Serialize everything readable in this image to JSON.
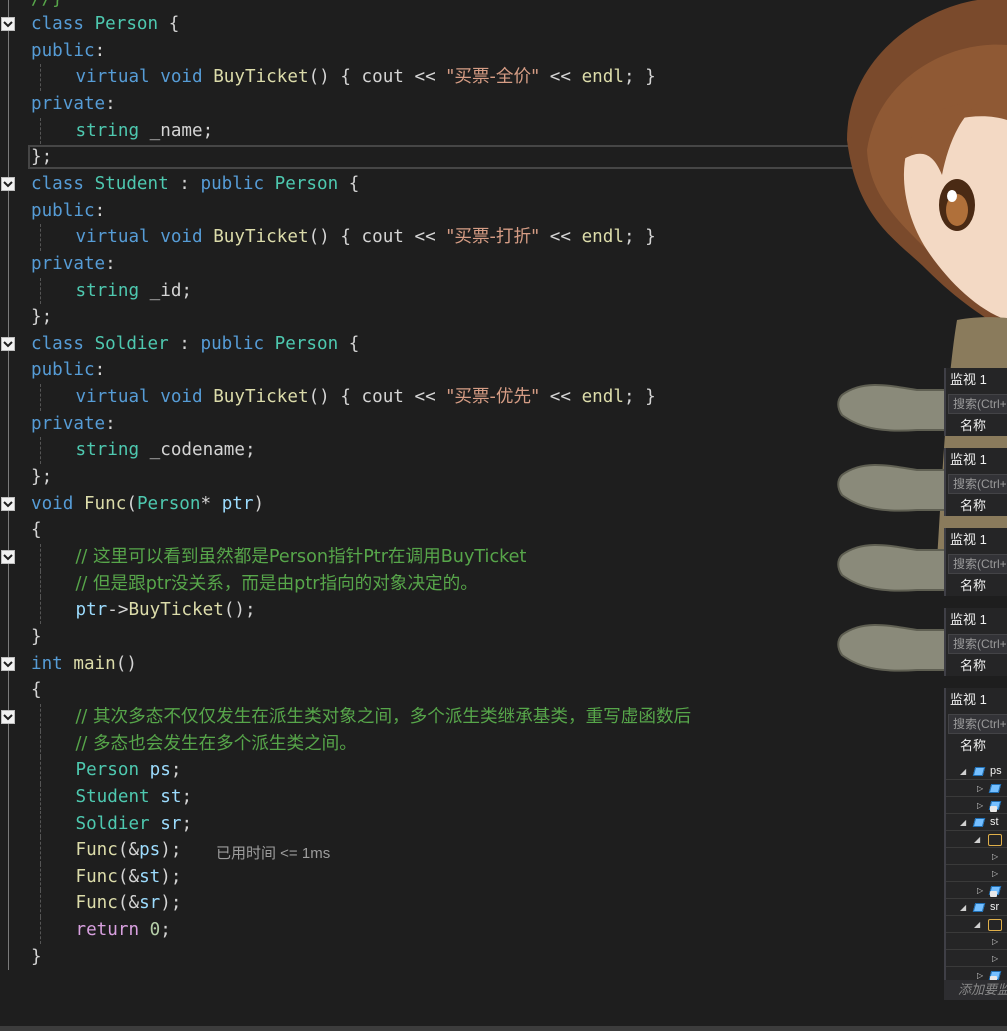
{
  "editor": {
    "top_fragment": "//}",
    "lines": [
      {
        "fold": true,
        "indent": 0,
        "tokens": [
          [
            "kw",
            "class"
          ],
          [
            "pl",
            " "
          ],
          [
            "type",
            "Person"
          ],
          [
            "pl",
            " {"
          ]
        ]
      },
      {
        "fold": false,
        "indent": 0,
        "tokens": [
          [
            "kw",
            "public"
          ],
          [
            "pl",
            ":"
          ]
        ]
      },
      {
        "fold": false,
        "indent": 1,
        "tokens": [
          [
            "kw",
            "virtual"
          ],
          [
            "pl",
            " "
          ],
          [
            "kw",
            "void"
          ],
          [
            "pl",
            " "
          ],
          [
            "fn",
            "BuyTicket"
          ],
          [
            "pl",
            "() { cout << "
          ],
          [
            "str",
            "\"买票-全价\""
          ],
          [
            "pl",
            " << "
          ],
          [
            "fn",
            "endl"
          ],
          [
            "pl",
            "; }"
          ]
        ]
      },
      {
        "fold": false,
        "indent": 0,
        "tokens": [
          [
            "kw",
            "private"
          ],
          [
            "pl",
            ":"
          ]
        ]
      },
      {
        "fold": false,
        "indent": 1,
        "tokens": [
          [
            "type",
            "string"
          ],
          [
            "pl",
            " _name;"
          ]
        ]
      },
      {
        "fold": false,
        "indent": 0,
        "tokens": [
          [
            "pl",
            "};"
          ]
        ]
      },
      {
        "fold": true,
        "indent": 0,
        "tokens": [
          [
            "kw",
            "class"
          ],
          [
            "pl",
            " "
          ],
          [
            "type",
            "Student"
          ],
          [
            "pl",
            " : "
          ],
          [
            "kw",
            "public"
          ],
          [
            "pl",
            " "
          ],
          [
            "type",
            "Person"
          ],
          [
            "pl",
            " {"
          ]
        ]
      },
      {
        "fold": false,
        "indent": 0,
        "tokens": [
          [
            "kw",
            "public"
          ],
          [
            "pl",
            ":"
          ]
        ]
      },
      {
        "fold": false,
        "indent": 1,
        "tokens": [
          [
            "kw",
            "virtual"
          ],
          [
            "pl",
            " "
          ],
          [
            "kw",
            "void"
          ],
          [
            "pl",
            " "
          ],
          [
            "fn",
            "BuyTicket"
          ],
          [
            "pl",
            "() { cout << "
          ],
          [
            "str",
            "\"买票-打折\""
          ],
          [
            "pl",
            " << "
          ],
          [
            "fn",
            "endl"
          ],
          [
            "pl",
            "; }"
          ]
        ]
      },
      {
        "fold": false,
        "indent": 0,
        "tokens": [
          [
            "kw",
            "private"
          ],
          [
            "pl",
            ":"
          ]
        ]
      },
      {
        "fold": false,
        "indent": 1,
        "tokens": [
          [
            "type",
            "string"
          ],
          [
            "pl",
            " _id;"
          ]
        ]
      },
      {
        "fold": false,
        "indent": 0,
        "tokens": [
          [
            "pl",
            "};"
          ]
        ]
      },
      {
        "fold": true,
        "indent": 0,
        "tokens": [
          [
            "kw",
            "class"
          ],
          [
            "pl",
            " "
          ],
          [
            "type",
            "Soldier"
          ],
          [
            "pl",
            " : "
          ],
          [
            "kw",
            "public"
          ],
          [
            "pl",
            " "
          ],
          [
            "type",
            "Person"
          ],
          [
            "pl",
            " {"
          ]
        ]
      },
      {
        "fold": false,
        "indent": 0,
        "tokens": [
          [
            "kw",
            "public"
          ],
          [
            "pl",
            ":"
          ]
        ]
      },
      {
        "fold": false,
        "indent": 1,
        "tokens": [
          [
            "kw",
            "virtual"
          ],
          [
            "pl",
            " "
          ],
          [
            "kw",
            "void"
          ],
          [
            "pl",
            " "
          ],
          [
            "fn",
            "BuyTicket"
          ],
          [
            "pl",
            "() { cout << "
          ],
          [
            "str",
            "\"买票-优先\""
          ],
          [
            "pl",
            " << "
          ],
          [
            "fn",
            "endl"
          ],
          [
            "pl",
            "; }"
          ]
        ]
      },
      {
        "fold": false,
        "indent": 0,
        "tokens": [
          [
            "kw",
            "private"
          ],
          [
            "pl",
            ":"
          ]
        ]
      },
      {
        "fold": false,
        "indent": 1,
        "tokens": [
          [
            "type",
            "string"
          ],
          [
            "pl",
            " _codename;"
          ]
        ]
      },
      {
        "fold": false,
        "indent": 0,
        "tokens": [
          [
            "pl",
            "};"
          ]
        ]
      },
      {
        "fold": true,
        "indent": 0,
        "tokens": [
          [
            "kw",
            "void"
          ],
          [
            "pl",
            " "
          ],
          [
            "fn",
            "Func"
          ],
          [
            "pl",
            "("
          ],
          [
            "type",
            "Person"
          ],
          [
            "pl",
            "* "
          ],
          [
            "var",
            "ptr"
          ],
          [
            "pl",
            ")"
          ]
        ]
      },
      {
        "fold": false,
        "indent": 0,
        "tokens": [
          [
            "pl",
            "{"
          ]
        ]
      },
      {
        "fold": true,
        "indent": 1,
        "tokens": [
          [
            "cm",
            "// 这里可以看到虽然都是Person指针Ptr在调用BuyTicket"
          ]
        ]
      },
      {
        "fold": false,
        "indent": 1,
        "tokens": [
          [
            "cm",
            "// 但是跟ptr没关系，而是由ptr指向的对象决定的。"
          ]
        ]
      },
      {
        "fold": false,
        "indent": 1,
        "tokens": [
          [
            "var",
            "ptr"
          ],
          [
            "pl",
            "->"
          ],
          [
            "fn",
            "BuyTicket"
          ],
          [
            "pl",
            "();"
          ]
        ]
      },
      {
        "fold": false,
        "indent": 0,
        "tokens": [
          [
            "pl",
            "}"
          ]
        ]
      },
      {
        "fold": true,
        "indent": 0,
        "tokens": [
          [
            "kw",
            "int"
          ],
          [
            "pl",
            " "
          ],
          [
            "fn",
            "main"
          ],
          [
            "pl",
            "()"
          ]
        ]
      },
      {
        "fold": false,
        "indent": 0,
        "tokens": [
          [
            "pl",
            "{"
          ]
        ]
      },
      {
        "fold": true,
        "indent": 1,
        "tokens": [
          [
            "cm",
            "// 其次多态不仅仅发生在派生类对象之间，多个派生类继承基类，重写虚函数后"
          ]
        ]
      },
      {
        "fold": false,
        "indent": 1,
        "tokens": [
          [
            "cm",
            "// 多态也会发生在多个派生类之间。"
          ]
        ]
      },
      {
        "fold": false,
        "indent": 1,
        "tokens": [
          [
            "type",
            "Person"
          ],
          [
            "pl",
            " "
          ],
          [
            "var",
            "ps"
          ],
          [
            "pl",
            ";"
          ]
        ]
      },
      {
        "fold": false,
        "indent": 1,
        "tokens": [
          [
            "type",
            "Student"
          ],
          [
            "pl",
            " "
          ],
          [
            "var",
            "st"
          ],
          [
            "pl",
            ";"
          ]
        ]
      },
      {
        "fold": false,
        "indent": 1,
        "tokens": [
          [
            "type",
            "Soldier"
          ],
          [
            "pl",
            " "
          ],
          [
            "var",
            "sr"
          ],
          [
            "pl",
            ";"
          ]
        ]
      },
      {
        "fold": false,
        "indent": 1,
        "tokens": [
          [
            "fn",
            "Func"
          ],
          [
            "pl",
            "(&"
          ],
          [
            "var",
            "ps"
          ],
          [
            "pl",
            ");"
          ]
        ]
      },
      {
        "fold": false,
        "indent": 1,
        "tokens": [
          [
            "fn",
            "Func"
          ],
          [
            "pl",
            "(&"
          ],
          [
            "var",
            "st"
          ],
          [
            "pl",
            ");"
          ]
        ]
      },
      {
        "fold": false,
        "indent": 1,
        "tokens": [
          [
            "fn",
            "Func"
          ],
          [
            "pl",
            "(&"
          ],
          [
            "var",
            "sr"
          ],
          [
            "pl",
            ");"
          ]
        ]
      },
      {
        "fold": false,
        "indent": 1,
        "tokens": [
          [
            "ctl",
            "return"
          ],
          [
            "pl",
            " "
          ],
          [
            "num",
            "0"
          ],
          [
            "pl",
            ";"
          ]
        ]
      },
      {
        "fold": false,
        "indent": 0,
        "tokens": [
          [
            "pl",
            "}"
          ]
        ]
      }
    ],
    "elapsed_hint": "已用时间 <= 1ms"
  },
  "watch_panels": [
    {
      "title": "监视 1",
      "search_placeholder": "搜索(Ctrl+E)",
      "name_header": "名称"
    },
    {
      "title": "监视 1",
      "search_placeholder": "搜索(Ctrl+E)",
      "name_header": "名称"
    },
    {
      "title": "监视 1",
      "search_placeholder": "搜索(Ctrl+E)",
      "name_header": "名称"
    },
    {
      "title": "监视 1",
      "search_placeholder": "搜索(Ctrl+E)",
      "name_header": "名称"
    },
    {
      "title": "监视 1",
      "search_placeholder": "搜索(Ctrl+E)",
      "name_header": "名称"
    }
  ],
  "watch_tree": [
    "ps",
    "st",
    "sr"
  ],
  "add_watch_text": "添加要监视的项"
}
